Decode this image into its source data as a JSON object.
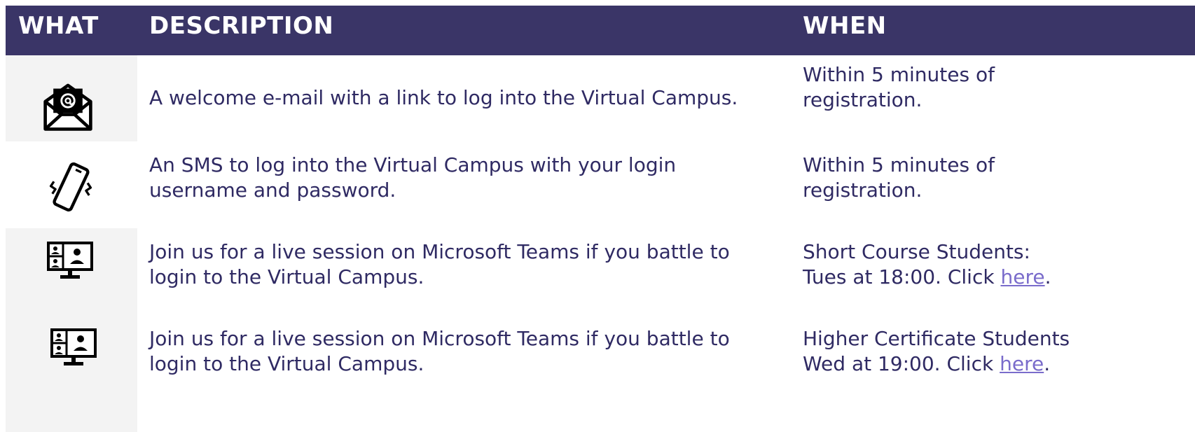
{
  "header": {
    "what": "WHAT",
    "description": "DESCRIPTION",
    "when": "WHEN"
  },
  "rows": [
    {
      "icon": "email-open-icon",
      "description": "A welcome e-mail with a link to log into the Virtual Campus.",
      "when_line1": "Within 5 minutes of",
      "when_line2": "registration."
    },
    {
      "icon": "vibrating-phone-icon",
      "description": "An SMS to log into the Virtual Campus with your login username and password.",
      "when_line1": "Within 5 minutes of",
      "when_line2": "registration."
    },
    {
      "icon": "video-conference-icon",
      "description": "Join us for a live session on Microsoft Teams if you battle to login to the Virtual Campus.",
      "when_line1": "Short Course Students:",
      "when_line2_prefix": "Tues at 18:00. Click ",
      "when_link": "here",
      "when_suffix": "."
    },
    {
      "icon": "video-conference-icon",
      "description": "Join us for a live session on Microsoft Teams if you battle to login to the Virtual Campus.",
      "when_line1": "Higher Certificate Students",
      "when_line2_prefix": "Wed at 19:00. Click ",
      "when_link": "here",
      "when_suffix": "."
    }
  ],
  "colors": {
    "header_bg": "#3a3567",
    "text": "#2f2a63",
    "link": "#7a6ccb",
    "what_column_bg": "#f3f3f3"
  }
}
